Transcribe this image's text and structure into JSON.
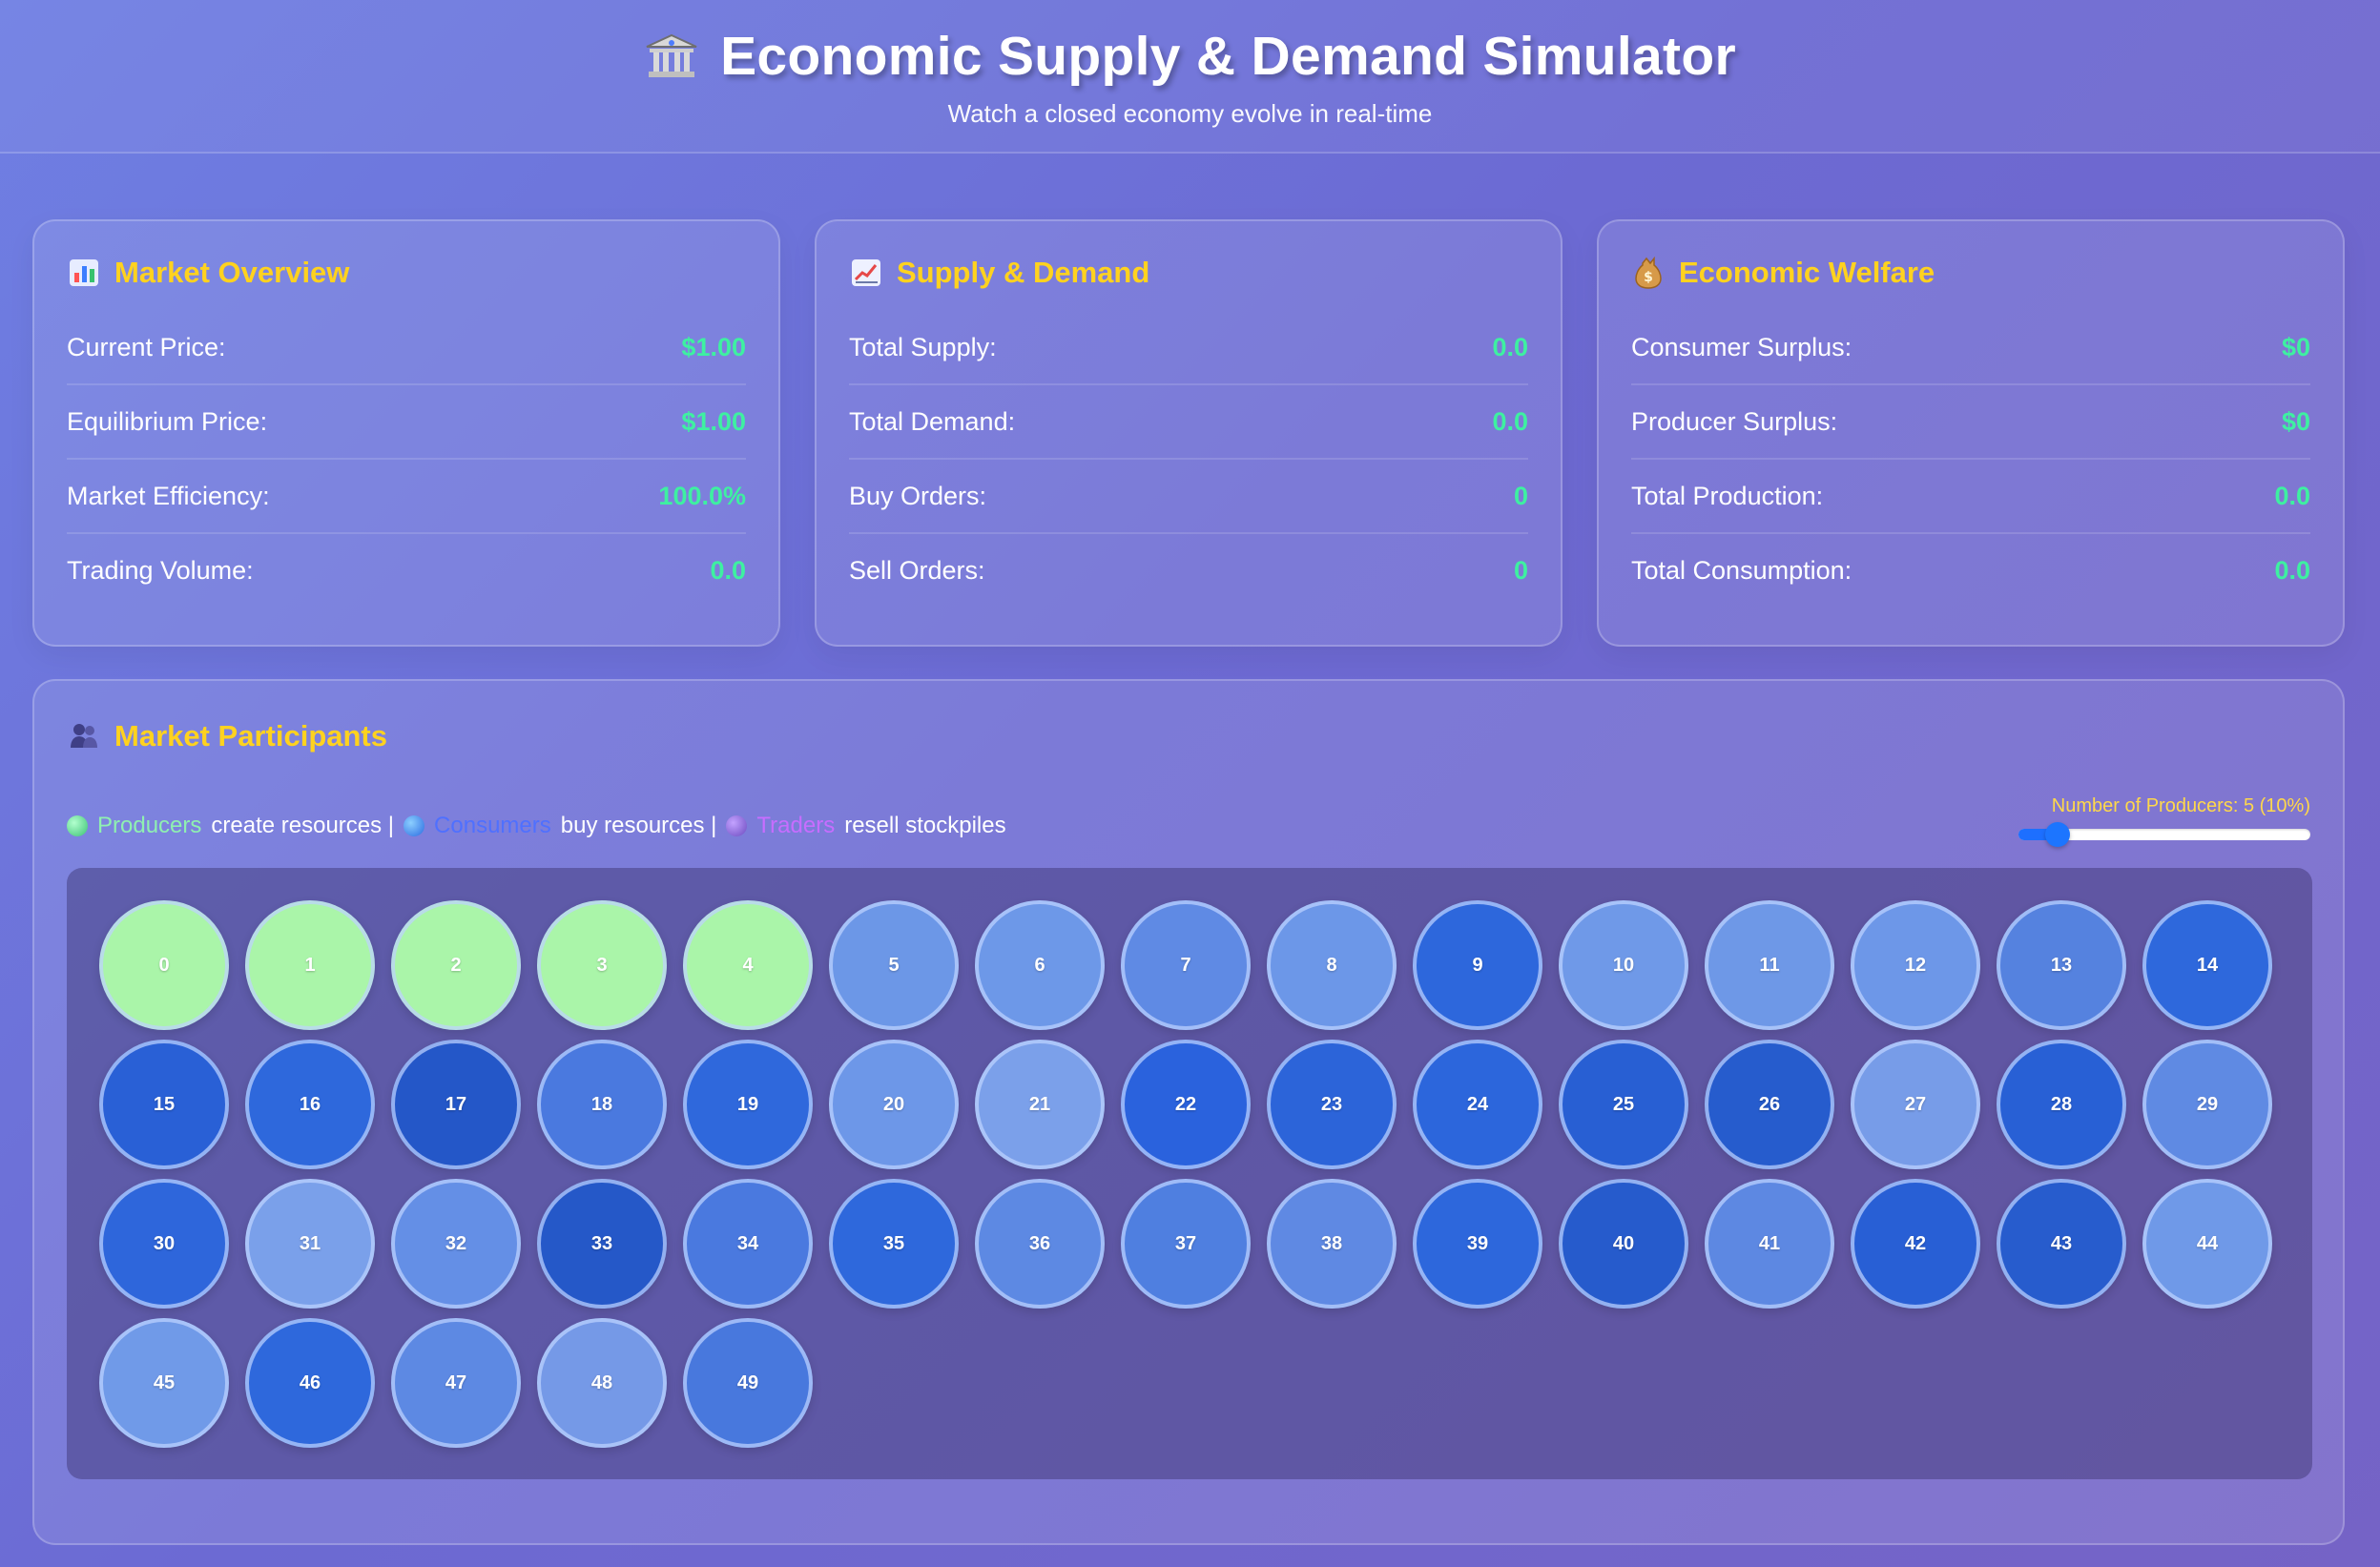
{
  "header": {
    "title": "Economic Supply & Demand Simulator",
    "subtitle": "Watch a closed economy evolve in real-time",
    "icon": "bank-icon"
  },
  "market_overview": {
    "title": "Market Overview",
    "icon": "chart-icon",
    "rows": [
      {
        "label": "Current Price:",
        "value": "$1.00"
      },
      {
        "label": "Equilibrium Price:",
        "value": "$1.00"
      },
      {
        "label": "Market Efficiency:",
        "value": "100.0%"
      },
      {
        "label": "Trading Volume:",
        "value": "0.0"
      }
    ]
  },
  "supply_demand": {
    "title": "Supply & Demand",
    "icon": "trend-icon",
    "rows": [
      {
        "label": "Total Supply:",
        "value": "0.0"
      },
      {
        "label": "Total Demand:",
        "value": "0.0"
      },
      {
        "label": "Buy Orders:",
        "value": "0"
      },
      {
        "label": "Sell Orders:",
        "value": "0"
      }
    ]
  },
  "economic_welfare": {
    "title": "Economic Welfare",
    "icon": "money-bag-icon",
    "rows": [
      {
        "label": "Consumer Surplus:",
        "value": "$0"
      },
      {
        "label": "Producer Surplus:",
        "value": "$0"
      },
      {
        "label": "Total Production:",
        "value": "0.0"
      },
      {
        "label": "Total Consumption:",
        "value": "0.0"
      }
    ]
  },
  "participants": {
    "title": "Market Participants",
    "icon": "people-icon",
    "legend": {
      "producers": "Producers",
      "producers_desc": "create resources |",
      "consumers": "Consumers",
      "consumers_desc": "buy resources |",
      "traders": "Traders",
      "traders_desc": "resell stockpiles"
    },
    "slider": {
      "label": "Number of Producers: 5 (10%)",
      "value": 5,
      "min": 0,
      "max": 50
    },
    "agents": [
      {
        "id": "0",
        "type": "producer",
        "color": "#aaf5a9"
      },
      {
        "id": "1",
        "type": "producer",
        "color": "#aaf5a9"
      },
      {
        "id": "2",
        "type": "producer",
        "color": "#aaf5a9"
      },
      {
        "id": "3",
        "type": "producer",
        "color": "#aaf5a9"
      },
      {
        "id": "4",
        "type": "producer",
        "color": "#aaf5a9"
      },
      {
        "id": "5",
        "type": "consumer",
        "color": "#6c97e7"
      },
      {
        "id": "6",
        "type": "consumer",
        "color": "#6d98e8"
      },
      {
        "id": "7",
        "type": "consumer",
        "color": "#5f8ae4"
      },
      {
        "id": "8",
        "type": "consumer",
        "color": "#6c97e8"
      },
      {
        "id": "9",
        "type": "consumer",
        "color": "#2d67dc"
      },
      {
        "id": "10",
        "type": "consumer",
        "color": "#6f99e8"
      },
      {
        "id": "11",
        "type": "consumer",
        "color": "#6e98e7"
      },
      {
        "id": "12",
        "type": "consumer",
        "color": "#6d97e8"
      },
      {
        "id": "13",
        "type": "consumer",
        "color": "#5582df"
      },
      {
        "id": "14",
        "type": "consumer",
        "color": "#2e68dc"
      },
      {
        "id": "15",
        "type": "consumer",
        "color": "#2960d6"
      },
      {
        "id": "16",
        "type": "consumer",
        "color": "#2e68dc"
      },
      {
        "id": "17",
        "type": "consumer",
        "color": "#2457c8"
      },
      {
        "id": "18",
        "type": "consumer",
        "color": "#4a79df"
      },
      {
        "id": "19",
        "type": "consumer",
        "color": "#2f68dc"
      },
      {
        "id": "20",
        "type": "consumer",
        "color": "#6d97e8"
      },
      {
        "id": "21",
        "type": "consumer",
        "color": "#7ba0ea"
      },
      {
        "id": "22",
        "type": "consumer",
        "color": "#2a62dd"
      },
      {
        "id": "23",
        "type": "consumer",
        "color": "#2c64d9"
      },
      {
        "id": "24",
        "type": "consumer",
        "color": "#2c66dc"
      },
      {
        "id": "25",
        "type": "consumer",
        "color": "#285fd3"
      },
      {
        "id": "26",
        "type": "consumer",
        "color": "#265ccd"
      },
      {
        "id": "27",
        "type": "consumer",
        "color": "#779ce8"
      },
      {
        "id": "28",
        "type": "consumer",
        "color": "#2860d5"
      },
      {
        "id": "29",
        "type": "consumer",
        "color": "#5f8ae3"
      },
      {
        "id": "30",
        "type": "consumer",
        "color": "#2e66db"
      },
      {
        "id": "31",
        "type": "consumer",
        "color": "#7aa0ea"
      },
      {
        "id": "32",
        "type": "consumer",
        "color": "#648fe6"
      },
      {
        "id": "33",
        "type": "consumer",
        "color": "#2558c8"
      },
      {
        "id": "34",
        "type": "consumer",
        "color": "#4a79df"
      },
      {
        "id": "35",
        "type": "consumer",
        "color": "#2e68dc"
      },
      {
        "id": "36",
        "type": "consumer",
        "color": "#5d89e3"
      },
      {
        "id": "37",
        "type": "consumer",
        "color": "#4f7fe0"
      },
      {
        "id": "38",
        "type": "consumer",
        "color": "#5f89e3"
      },
      {
        "id": "39",
        "type": "consumer",
        "color": "#2d67dc"
      },
      {
        "id": "40",
        "type": "consumer",
        "color": "#265bcc"
      },
      {
        "id": "41",
        "type": "consumer",
        "color": "#5d88e2"
      },
      {
        "id": "42",
        "type": "consumer",
        "color": "#285fd5"
      },
      {
        "id": "43",
        "type": "consumer",
        "color": "#275ccd"
      },
      {
        "id": "44",
        "type": "consumer",
        "color": "#6f99e8"
      },
      {
        "id": "45",
        "type": "consumer",
        "color": "#709ae8"
      },
      {
        "id": "46",
        "type": "consumer",
        "color": "#2e68dc"
      },
      {
        "id": "47",
        "type": "consumer",
        "color": "#5d89e3"
      },
      {
        "id": "48",
        "type": "consumer",
        "color": "#7599e7"
      },
      {
        "id": "49",
        "type": "consumer",
        "color": "#4878dd"
      }
    ]
  }
}
